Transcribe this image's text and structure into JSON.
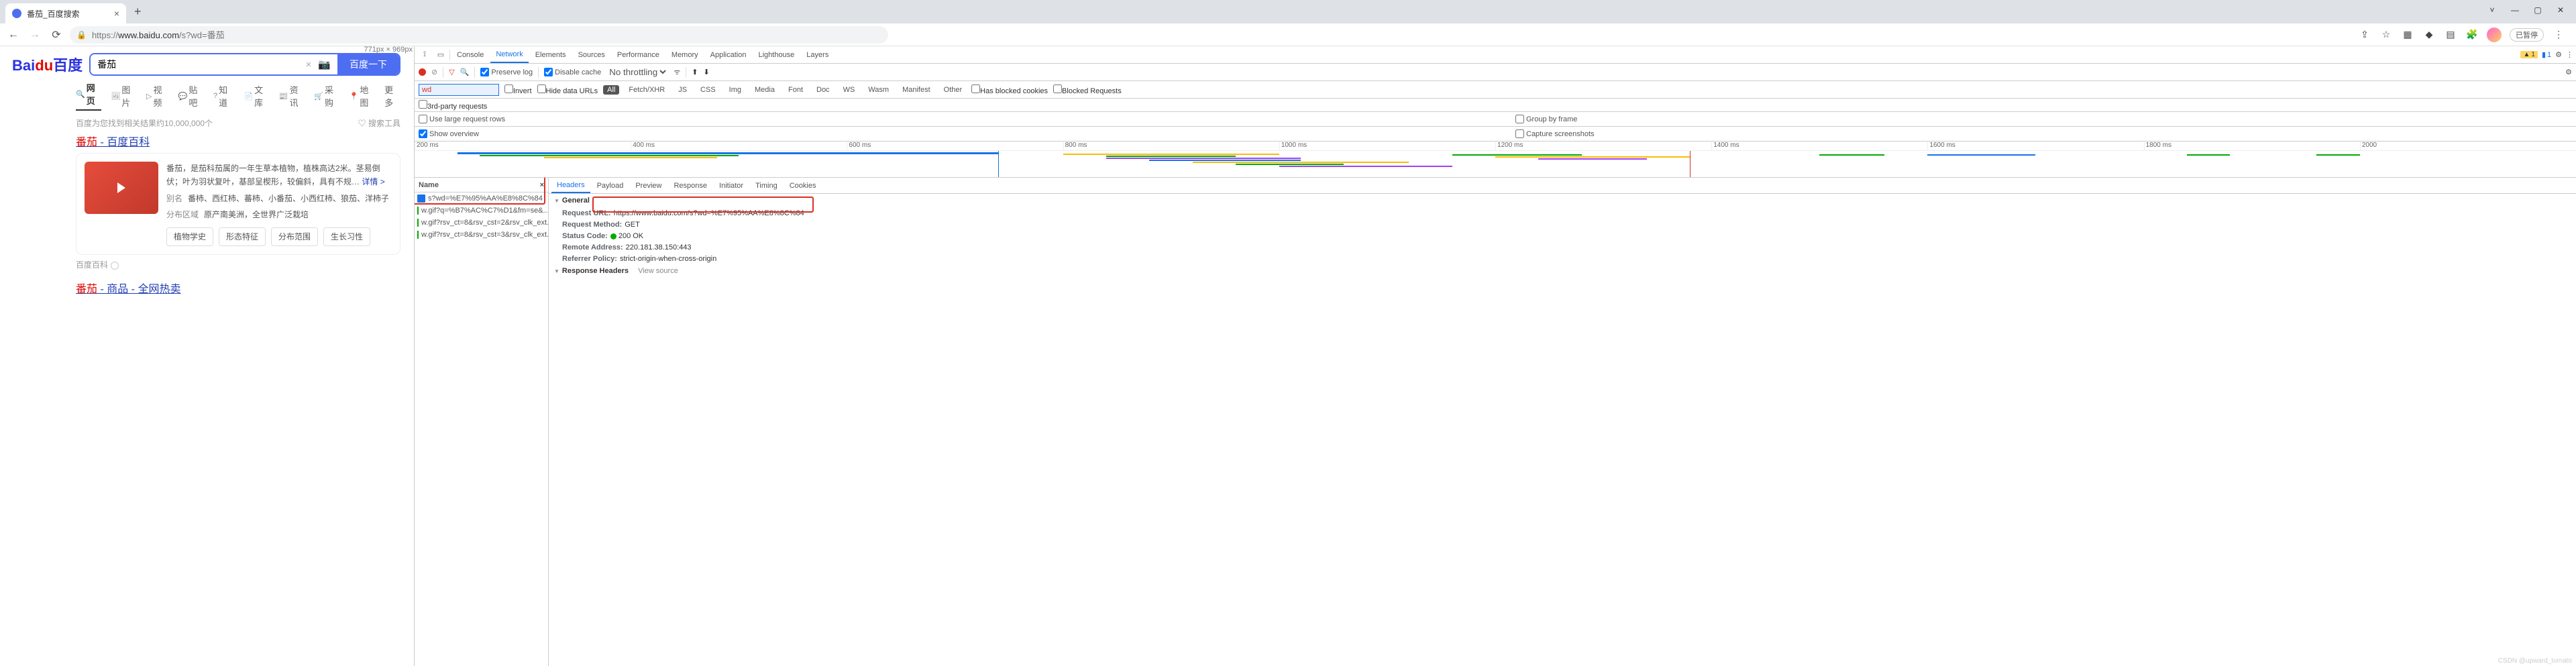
{
  "browser": {
    "tab_title": "番茄_百度搜索",
    "url_display": "https://www.baidu.com/s?wd=番茄",
    "url_prefix": "https://",
    "url_host": "www.baidu.com",
    "url_path": "/s?wd=番茄",
    "pause_label": "已暂停"
  },
  "dim_label": "771px × 969px",
  "baidu": {
    "logo": "Bai",
    "logo2": "百度",
    "search_value": "番茄",
    "search_btn": "百度一下",
    "tabs": [
      "网页",
      "图片",
      "视频",
      "贴吧",
      "知道",
      "文库",
      "资讯",
      "采购",
      "地图",
      "更多"
    ],
    "results_count": "百度为您找到相关结果约10,000,000个",
    "tools_label": "搜索工具",
    "result1_hl": "番茄",
    "result1_rest": " - 百度百科",
    "card_desc": "番茄，是茄科茄属的一年生草本植物，植株高达2米。茎易倒伏；叶为羽状复叶，基部呈楔形，较偏斜，具有不规…",
    "card_more": "详情 >",
    "meta_k1": "别名",
    "meta_v1": "番柿、西红柿、蕃柿、小番茄、小西红柿、狼茄、洋柿子",
    "meta_k2": "分布区域",
    "meta_v2": "原产南美洲，全世界广泛栽培",
    "buttons": [
      "植物学史",
      "形态特征",
      "分布范围",
      "生长习性"
    ],
    "source": "百度百科",
    "result2_hl": "番茄",
    "result2_rest": " - 商品 - 全网热卖"
  },
  "devtools": {
    "tabs": [
      "Console",
      "Network",
      "Elements",
      "Sources",
      "Performance",
      "Memory",
      "Application",
      "Lighthouse",
      "Layers"
    ],
    "warn_count": "1",
    "msg_count": "1",
    "preserve_log": "Preserve log",
    "disable_cache": "Disable cache",
    "throttling": "No throttling",
    "filter_value": "wd",
    "invert": "Invert",
    "hide_data": "Hide data URLs",
    "type_pills": [
      "All",
      "Fetch/XHR",
      "JS",
      "CSS",
      "Img",
      "Media",
      "Font",
      "Doc",
      "WS",
      "Wasm",
      "Manifest",
      "Other"
    ],
    "blocked_cookies": "Has blocked cookies",
    "blocked_req": "Blocked Requests",
    "third_party": "3rd-party requests",
    "large_rows": "Use large request rows",
    "group_frame": "Group by frame",
    "show_overview": "Show overview",
    "capture_ss": "Capture screenshots",
    "timeline_ticks": [
      "200 ms",
      "400 ms",
      "600 ms",
      "800 ms",
      "1000 ms",
      "1200 ms",
      "1400 ms",
      "1600 ms",
      "1800 ms",
      "2000"
    ],
    "name_header": "Name",
    "requests": [
      "s?wd=%E7%95%AA%E8%8C%84",
      "w.gif?q=%B7%AC%C7%D1&fm=se&...",
      "w.gif?rsv_ct=8&rsv_cst=2&rsv_clk_ext...",
      "w.gif?rsv_ct=8&rsv_cst=3&rsv_clk_ext..."
    ],
    "detail_tabs": [
      "Headers",
      "Payload",
      "Preview",
      "Response",
      "Initiator",
      "Timing",
      "Cookies"
    ],
    "general_label": "General",
    "req_url_k": "Request URL:",
    "req_url_v": "https://www.baidu.com/s?wd=%E7%95%AA%E8%8C%84",
    "req_method_k": "Request Method:",
    "req_method_v": "GET",
    "status_k": "Status Code:",
    "status_v": "200  OK",
    "remote_k": "Remote Address:",
    "remote_v": "220.181.38.150:443",
    "referrer_k": "Referrer Policy:",
    "referrer_v": "strict-origin-when-cross-origin",
    "resp_headers_label": "Response Headers",
    "view_source": "View source"
  },
  "watermark": "CSDN @upward_tomato"
}
